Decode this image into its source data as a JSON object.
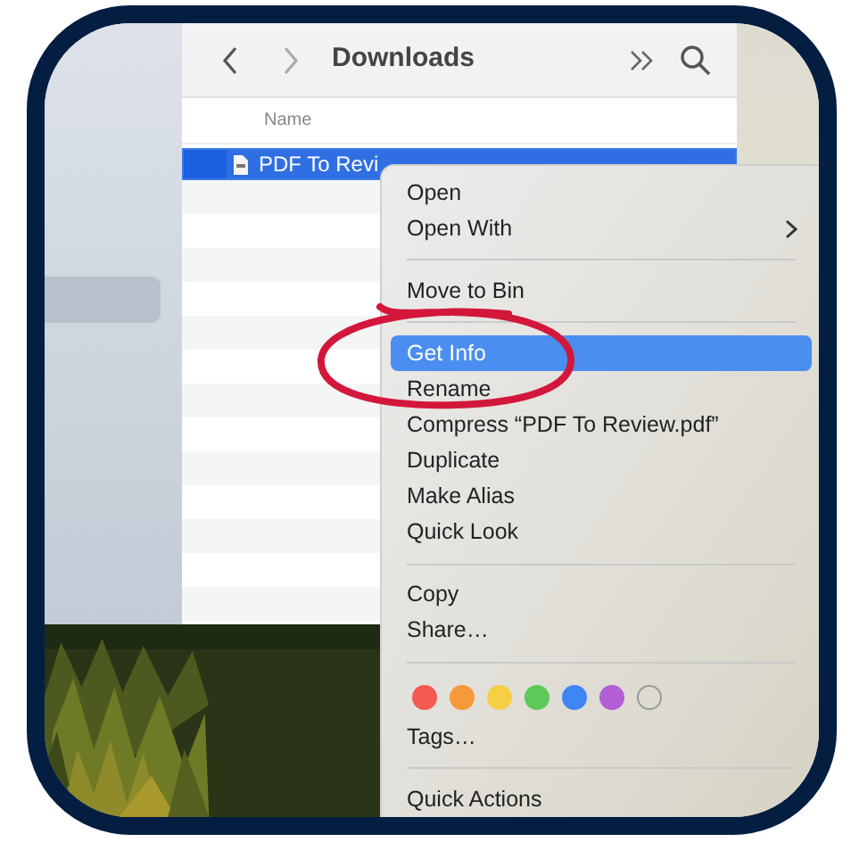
{
  "finder": {
    "title": "Downloads",
    "column_header": "Name",
    "selected_file": "PDF To Revi"
  },
  "context_menu": {
    "items": [
      {
        "kind": "item",
        "label": "Open",
        "selected": false
      },
      {
        "kind": "submenu",
        "label": "Open With",
        "selected": false
      },
      {
        "kind": "separator"
      },
      {
        "kind": "item",
        "label": "Move to Bin",
        "selected": false
      },
      {
        "kind": "separator"
      },
      {
        "kind": "item",
        "label": "Get Info",
        "selected": true
      },
      {
        "kind": "item",
        "label": "Rename",
        "selected": false
      },
      {
        "kind": "item",
        "label": "Compress “PDF To Review.pdf”",
        "selected": false
      },
      {
        "kind": "item",
        "label": "Duplicate",
        "selected": false
      },
      {
        "kind": "item",
        "label": "Make Alias",
        "selected": false
      },
      {
        "kind": "item",
        "label": "Quick Look",
        "selected": false
      },
      {
        "kind": "separator"
      },
      {
        "kind": "item",
        "label": "Copy",
        "selected": false
      },
      {
        "kind": "item",
        "label": "Share…",
        "selected": false
      },
      {
        "kind": "separator"
      },
      {
        "kind": "tags",
        "tags": [
          {
            "kind": "color",
            "color": "#f25a52"
          },
          {
            "kind": "color",
            "color": "#f5993a"
          },
          {
            "kind": "color",
            "color": "#f7cf45"
          },
          {
            "kind": "color",
            "color": "#5cc95a"
          },
          {
            "kind": "color",
            "color": "#3f86f5"
          },
          {
            "kind": "color",
            "color": "#b25ed6"
          },
          {
            "kind": "empty"
          }
        ]
      },
      {
        "kind": "item",
        "label": "Tags…",
        "selected": false
      },
      {
        "kind": "separator"
      },
      {
        "kind": "item",
        "label": "Quick Actions",
        "selected": false
      }
    ]
  }
}
